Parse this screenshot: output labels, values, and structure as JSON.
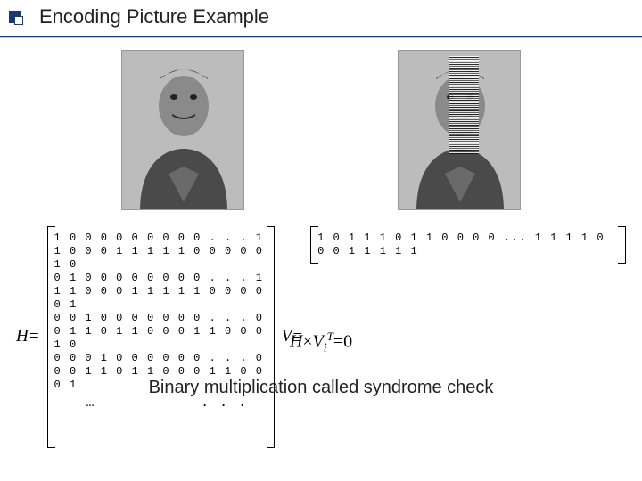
{
  "title": "Encoding Picture Example",
  "images": {
    "original_alt": "Original grayscale portrait",
    "stego_alt": "Stego portrait with noise band"
  },
  "H_label": "H=",
  "H_matrix": {
    "rows": [
      "1 0 0 0 0 0 0 0 0 0 . . . 1 1 0 0 0 1 1 1 1 1 0 0 0 0 0 1 0",
      "0 1 0 0 0 0 0 0 0 0 . . . 1 1 1 0 0 0 1 1 1 1 1 0 0 0 0 0 1",
      "0 0 1 0 0 0 0 0 0 0 . . . 0 0 1 1 0 1 1 0 0 0 1 1 0 0 0 1 0",
      "0 0 0 1 0 0 0 0 0 0 . . . 0 0 0 1 1 0 1 1 0 0 0 1 1 0 0 0 1"
    ],
    "ellipsis_left": "…",
    "ellipsis_right": ". . ."
  },
  "V_label": "V=",
  "V_vector": "1 0 1 1 1 0 1 1 0 0 0 0  ...  1 1 1 1 0 0 0 1 1 1 1 1",
  "equation": {
    "lhs_H": "H",
    "times": "×",
    "V": "V",
    "sub": "i",
    "sup": "T",
    "rhs": "=0"
  },
  "caption": "Binary multiplication called syndrome check"
}
